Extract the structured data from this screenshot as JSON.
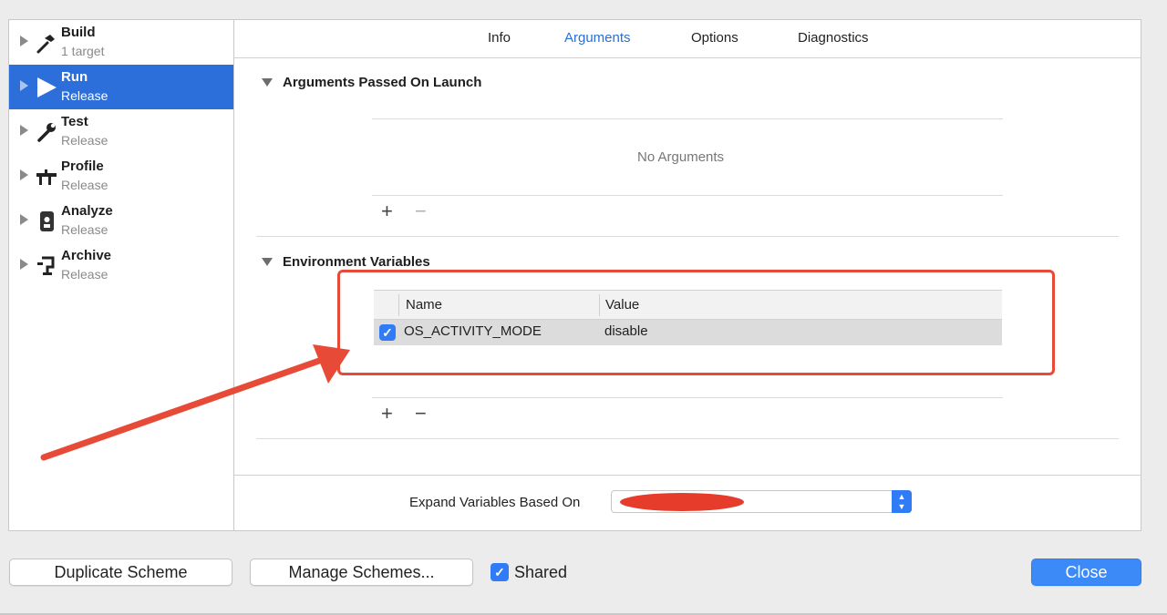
{
  "sidebar": {
    "items": [
      {
        "name": "Build",
        "sub": "1 target",
        "icon": "hammer-icon"
      },
      {
        "name": "Run",
        "sub": "Release",
        "icon": "play-icon"
      },
      {
        "name": "Test",
        "sub": "Release",
        "icon": "wrench-icon"
      },
      {
        "name": "Profile",
        "sub": "Release",
        "icon": "gauge-icon"
      },
      {
        "name": "Analyze",
        "sub": "Release",
        "icon": "analyze-icon"
      },
      {
        "name": "Archive",
        "sub": "Release",
        "icon": "archive-icon"
      }
    ],
    "selected_index": 1,
    "selected_color": "#2c6fdb"
  },
  "tabs": [
    {
      "label": "Info"
    },
    {
      "label": "Arguments"
    },
    {
      "label": "Options"
    },
    {
      "label": "Diagnostics"
    }
  ],
  "active_tab": "Arguments",
  "arguments": {
    "title": "Arguments Passed On Launch",
    "empty_text": "No Arguments",
    "add_label": "+",
    "remove_label": "−"
  },
  "environment": {
    "title": "Environment Variables",
    "columns": [
      "Name",
      "Value"
    ],
    "rows": [
      {
        "enabled": true,
        "name": "OS_ACTIVITY_MODE",
        "value": "disable"
      }
    ],
    "add_label": "+",
    "remove_label": "−"
  },
  "expand": {
    "label": "Expand Variables Based On",
    "selected_value": ""
  },
  "buttons": {
    "duplicate": "Duplicate Scheme",
    "manage": "Manage Schemes...",
    "shared_label": "Shared",
    "shared_checked": true,
    "close": "Close"
  },
  "colors": {
    "accent": "#2f7cf6",
    "annotation": "#e74b37"
  }
}
